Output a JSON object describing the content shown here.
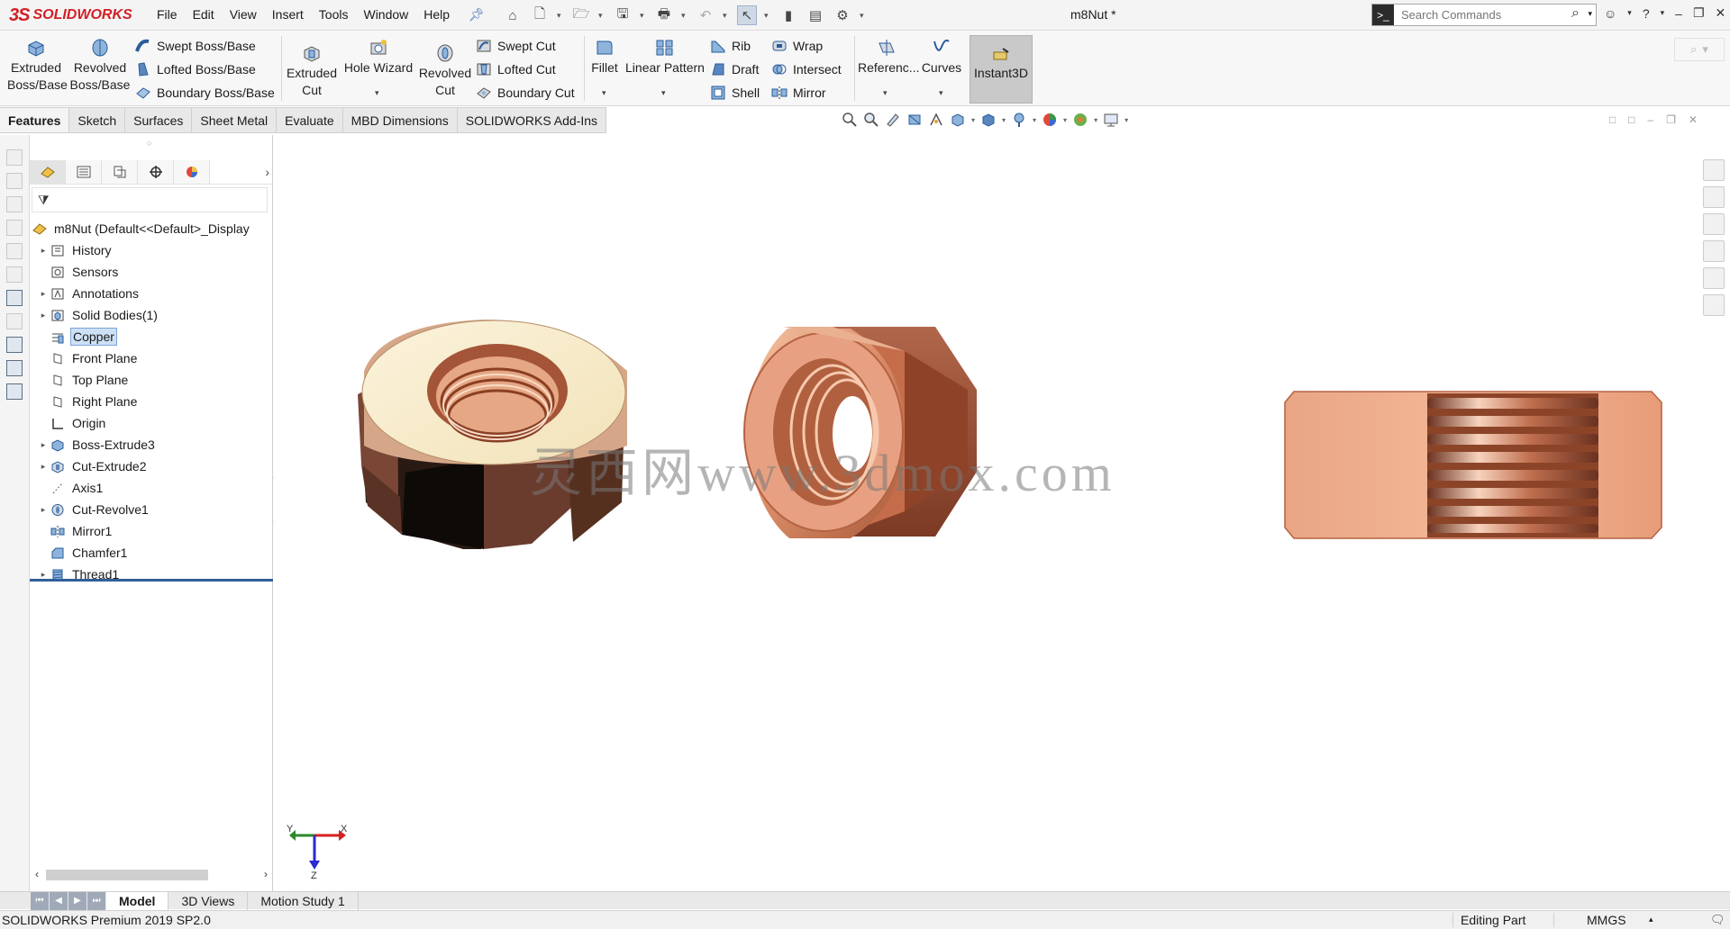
{
  "app": {
    "logo_prefix": "3S",
    "logo_text": "SOLIDWORKS",
    "document_title": "m8Nut *"
  },
  "menu": [
    "File",
    "Edit",
    "View",
    "Insert",
    "Tools",
    "Window",
    "Help"
  ],
  "search": {
    "placeholder": "Search Commands"
  },
  "commands": {
    "extruded_boss": [
      "Extruded",
      "Boss/Base"
    ],
    "revolved_boss": [
      "Revolved",
      "Boss/Base"
    ],
    "swept_boss": "Swept Boss/Base",
    "lofted_boss": "Lofted Boss/Base",
    "boundary_boss": "Boundary Boss/Base",
    "extruded_cut": [
      "Extruded",
      "Cut"
    ],
    "hole_wizard": "Hole Wizard",
    "revolved_cut": [
      "Revolved",
      "Cut"
    ],
    "swept_cut": "Swept Cut",
    "lofted_cut": "Lofted Cut",
    "boundary_cut": "Boundary Cut",
    "fillet": "Fillet",
    "linear_pattern": "Linear Pattern",
    "rib": "Rib",
    "draft": "Draft",
    "shell": "Shell",
    "wrap": "Wrap",
    "intersect": "Intersect",
    "mirror": "Mirror",
    "reference": "Referenc...",
    "curves": "Curves",
    "instant3d": "Instant3D"
  },
  "tabs": [
    "Features",
    "Sketch",
    "Surfaces",
    "Sheet Metal",
    "Evaluate",
    "MBD Dimensions",
    "SOLIDWORKS Add-Ins"
  ],
  "tree": {
    "root": "m8Nut  (Default<<Default>_Display",
    "items": [
      {
        "label": "History",
        "icon": "history-icon",
        "expandable": true
      },
      {
        "label": "Sensors",
        "icon": "sensors-icon",
        "expandable": false
      },
      {
        "label": "Annotations",
        "icon": "annotations-icon",
        "expandable": true
      },
      {
        "label": "Solid Bodies(1)",
        "icon": "solid-bodies-icon",
        "expandable": true
      },
      {
        "label": "Copper",
        "icon": "material-icon",
        "expandable": false,
        "selected": true
      },
      {
        "label": "Front Plane",
        "icon": "plane-icon",
        "expandable": false
      },
      {
        "label": "Top Plane",
        "icon": "plane-icon",
        "expandable": false
      },
      {
        "label": "Right Plane",
        "icon": "plane-icon",
        "expandable": false
      },
      {
        "label": "Origin",
        "icon": "origin-icon",
        "expandable": false
      },
      {
        "label": "Boss-Extrude3",
        "icon": "boss-extrude-icon",
        "expandable": true
      },
      {
        "label": "Cut-Extrude2",
        "icon": "cut-extrude-icon",
        "expandable": true
      },
      {
        "label": "Axis1",
        "icon": "axis-icon",
        "expandable": false
      },
      {
        "label": "Cut-Revolve1",
        "icon": "cut-revolve-icon",
        "expandable": true
      },
      {
        "label": "Mirror1",
        "icon": "mirror-icon",
        "expandable": false
      },
      {
        "label": "Chamfer1",
        "icon": "chamfer-icon",
        "expandable": false
      },
      {
        "label": "Thread1",
        "icon": "thread-icon",
        "expandable": true
      }
    ]
  },
  "viewport": {
    "watermark": "灵西网www.3dmox.com",
    "triad": {
      "y": "Y",
      "x": "X",
      "z": "Z"
    }
  },
  "bottom_tabs": [
    "Model",
    "3D Views",
    "Motion Study 1"
  ],
  "status": {
    "product": "SOLIDWORKS Premium 2019 SP2.0",
    "mode": "Editing Part",
    "units": "MMGS"
  },
  "colors": {
    "brand": "#d21f26",
    "copper_light": "#f3b796",
    "copper_mid": "#c97a58",
    "copper_dark": "#7a3c26",
    "selection": "#cde0f5"
  }
}
